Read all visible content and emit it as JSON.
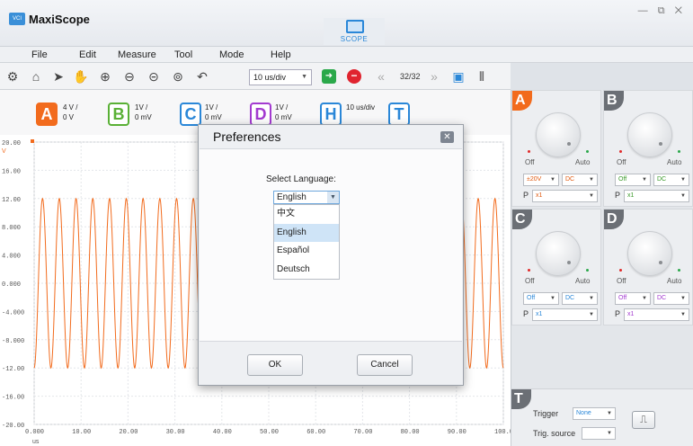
{
  "app": {
    "title": "MaxiScope",
    "logo_text": "VCI",
    "mode_label": "SCOPE",
    "window_controls": "— ⧉ ✕"
  },
  "menu": [
    "File",
    "Edit",
    "Measure",
    "Tool",
    "Mode",
    "Help"
  ],
  "toolbar": {
    "timebase": "10 us/div",
    "frame": "32/32"
  },
  "channels": [
    {
      "id": "A",
      "color": "#f26b1d",
      "line1": "4 V /",
      "line2": "0 V"
    },
    {
      "id": "B",
      "color": "#59b035",
      "line1": "1V /",
      "line2": "0 mV"
    },
    {
      "id": "C",
      "color": "#2a87d8",
      "line1": "1V /",
      "line2": "0 mV"
    },
    {
      "id": "D",
      "color": "#a33ad0",
      "line1": "1V /",
      "line2": "0 mV"
    },
    {
      "id": "H",
      "color": "#2a87d8",
      "line1": "10 us/div",
      "line2": ""
    },
    {
      "id": "T",
      "color": "#2a87d8",
      "line1": "",
      "line2": ""
    }
  ],
  "chart_data": {
    "type": "line",
    "title": "",
    "xlabel": "us",
    "ylabel": "V",
    "xlim": [
      0,
      100
    ],
    "ylim": [
      -20,
      20
    ],
    "x_ticks": [
      "0.000",
      "10.00",
      "20.00",
      "30.00",
      "40.00",
      "50.00",
      "60.00",
      "70.00",
      "80.00",
      "90.00",
      "100.0"
    ],
    "y_ticks": [
      "20.00",
      "16.00",
      "12.00",
      "8.000",
      "4.000",
      "0.000",
      "-4.000",
      "-8.000",
      "-12.00",
      "-16.00",
      "-20.00"
    ],
    "series": [
      {
        "color": "#f26b1d",
        "amplitude": 12,
        "offset": 0,
        "cycles": 28
      }
    ]
  },
  "panels": {
    "A": {
      "off": "Off",
      "auto": "Auto",
      "range": "±20V",
      "coupling": "DC",
      "probe_label": "P",
      "probe": "x1"
    },
    "B": {
      "off": "Off",
      "auto": "Auto",
      "range": "Off",
      "coupling": "DC",
      "probe_label": "P",
      "probe": "x1"
    },
    "C": {
      "off": "Off",
      "auto": "Auto",
      "range": "Off",
      "coupling": "DC",
      "probe_label": "P",
      "probe": "x1"
    },
    "D": {
      "off": "Off",
      "auto": "Auto",
      "range": "Off",
      "coupling": "DC",
      "probe_label": "P",
      "probe": "x1"
    }
  },
  "trigger": {
    "tag": "T",
    "trigger_label": "Trigger",
    "trigger_value": "None",
    "source_label": "Trig. source",
    "source_value": ""
  },
  "dialog": {
    "title": "Preferences",
    "language_label": "Select Language:",
    "selected": "English",
    "options": [
      "中文",
      "English",
      "Español",
      "Deutsch"
    ],
    "highlighted_index": 1,
    "ok": "OK",
    "cancel": "Cancel"
  }
}
